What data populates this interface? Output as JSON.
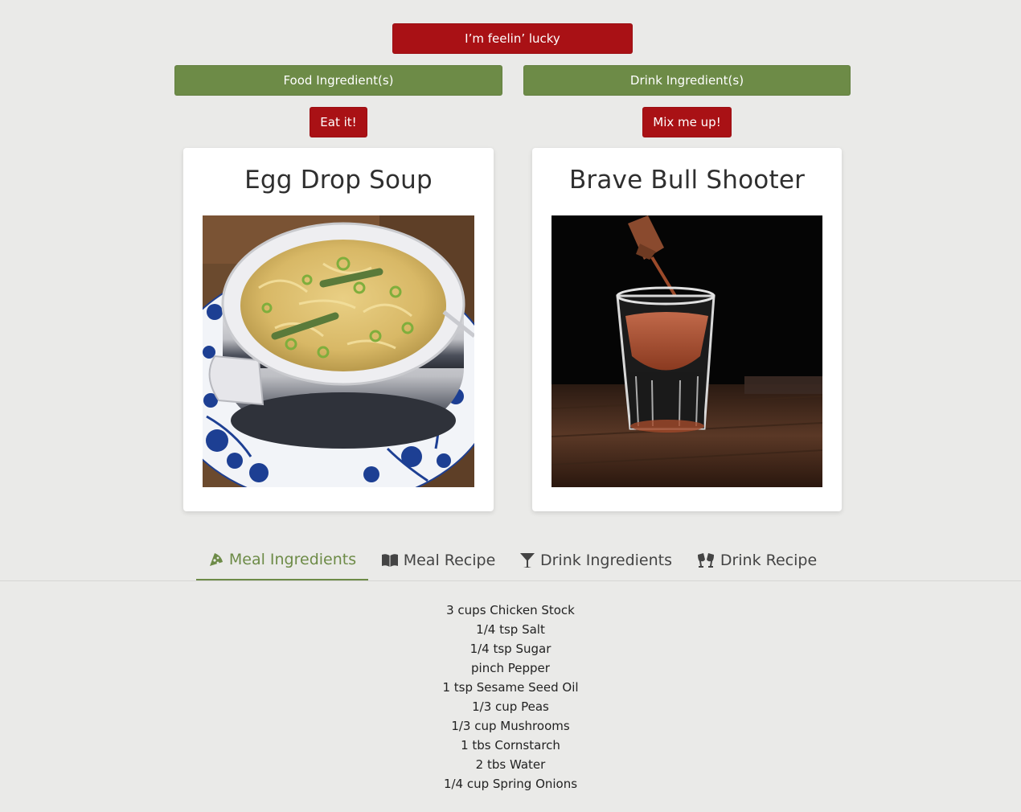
{
  "buttons": {
    "lucky": "I’m feelin’ lucky",
    "food_ingredients": "Food Ingredient(s)",
    "drink_ingredients": "Drink Ingredient(s)",
    "eat": "Eat it!",
    "mix": "Mix me up!"
  },
  "meal": {
    "title": "Egg Drop Soup"
  },
  "drink": {
    "title": "Brave Bull Shooter"
  },
  "tabs": [
    {
      "label": "Meal Ingredients",
      "icon": "pizza-slice-icon",
      "active": true
    },
    {
      "label": "Meal Recipe",
      "icon": "book-open-icon",
      "active": false
    },
    {
      "label": "Drink Ingredients",
      "icon": "cocktail-glass-icon",
      "active": false
    },
    {
      "label": "Drink Recipe",
      "icon": "glasses-cheers-icon",
      "active": false
    }
  ],
  "ingredients": [
    {
      "measure": "3 cups",
      "name": "Chicken Stock"
    },
    {
      "measure": "1/4 tsp",
      "name": "Salt"
    },
    {
      "measure": "1/4 tsp",
      "name": "Sugar"
    },
    {
      "measure": "pinch",
      "name": "Pepper"
    },
    {
      "measure": "1 tsp",
      "name": "Sesame Seed Oil"
    },
    {
      "measure": "1/3 cup",
      "name": "Peas"
    },
    {
      "measure": "1/3 cup",
      "name": "Mushrooms"
    },
    {
      "measure": "1 tbs",
      "name": "Cornstarch"
    },
    {
      "measure": "2 tbs",
      "name": "Water"
    },
    {
      "measure": "1/4 cup",
      "name": "Spring Onions"
    }
  ],
  "colors": {
    "background": "#eaeae8",
    "accent_red": "#a91115",
    "accent_green": "#6d8b47"
  }
}
